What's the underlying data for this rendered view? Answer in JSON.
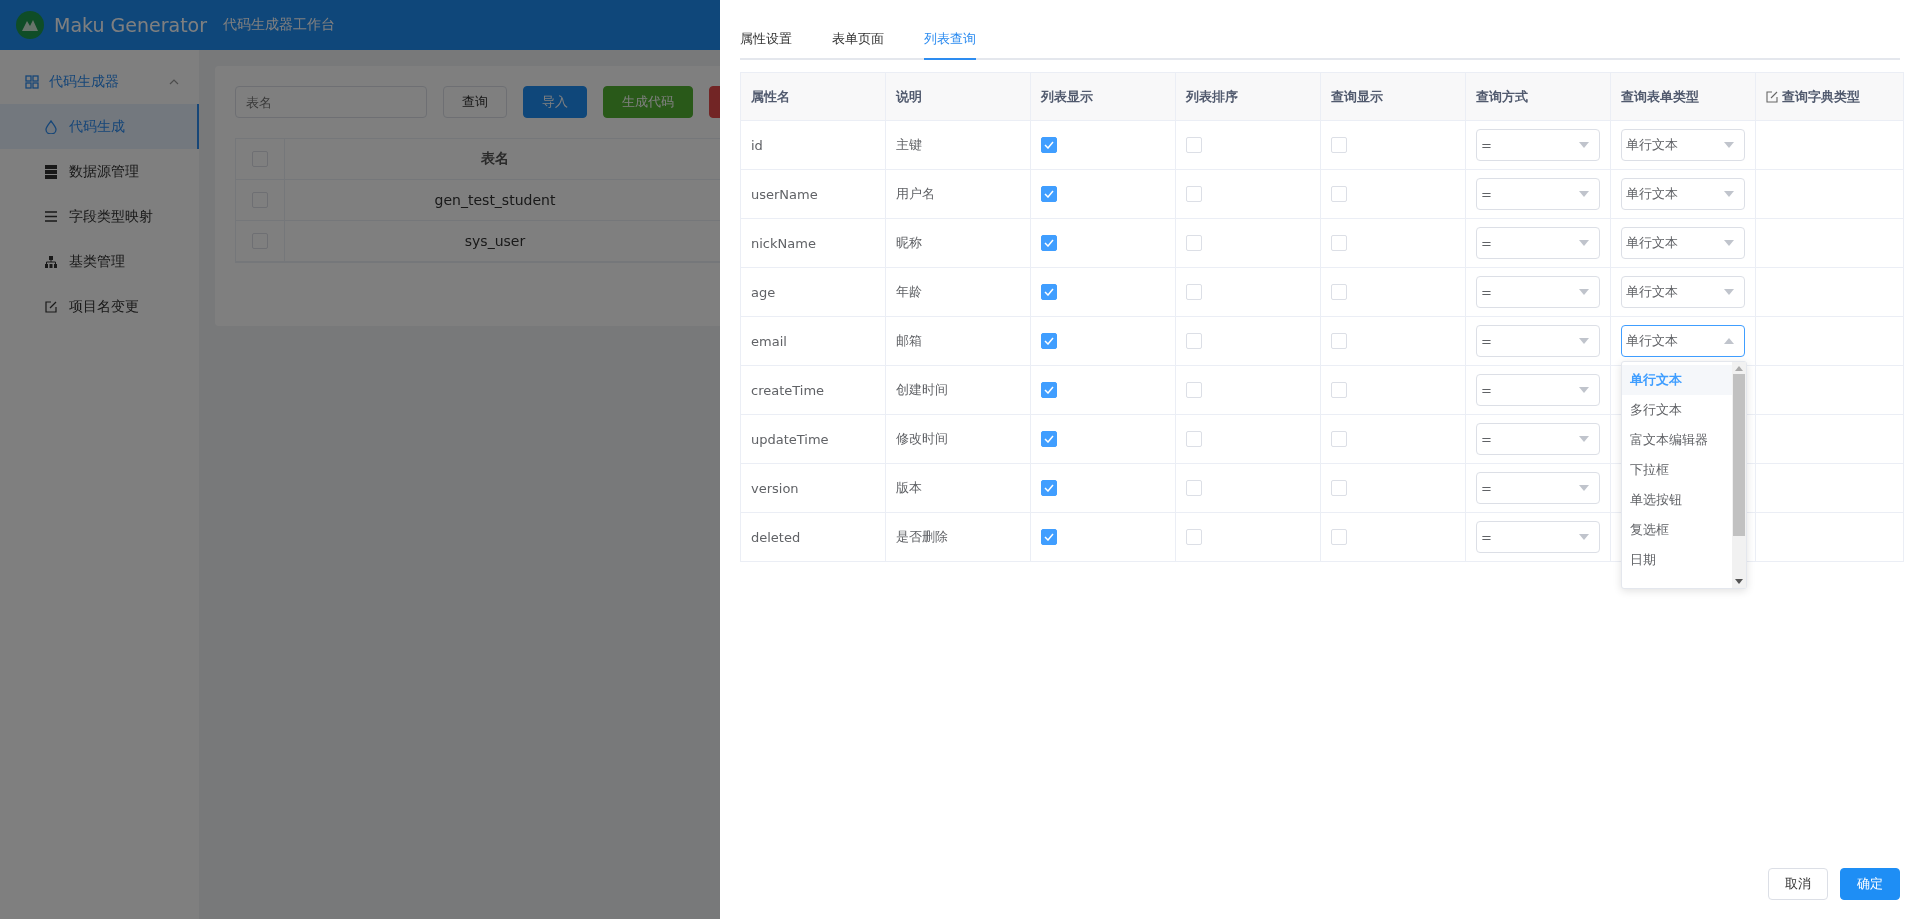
{
  "app": {
    "brand": "Maku Generator",
    "subtitle": "代码生成器工作台"
  },
  "sidebar": {
    "groups": [
      {
        "label": "代码生成器",
        "expanded": true,
        "children": [
          {
            "label": "代码生成",
            "selected": true
          },
          {
            "label": "数据源管理",
            "selected": false
          },
          {
            "label": "字段类型映射",
            "selected": false
          },
          {
            "label": "基类管理",
            "selected": false
          },
          {
            "label": "项目名变更",
            "selected": false
          }
        ]
      }
    ]
  },
  "toolbar": {
    "search": {
      "placeholder": "表名"
    },
    "buttons": [
      {
        "label": "查询",
        "kind": "default"
      },
      {
        "label": "导入",
        "kind": "primary"
      },
      {
        "label": "生成代码",
        "kind": "success"
      },
      {
        "kind": "danger"
      }
    ]
  },
  "table": {
    "select_all": false,
    "columns": [
      "表名"
    ],
    "rows": [
      {
        "name": "gen_test_student",
        "checked": false
      },
      {
        "name": "sys_user",
        "checked": false
      }
    ]
  },
  "drawer": {
    "tabs": [
      {
        "label": "属性设置",
        "selected": false
      },
      {
        "label": "表单页面",
        "selected": false
      },
      {
        "label": "列表查询",
        "selected": true
      }
    ],
    "columns": [
      "属性名",
      "说明",
      "列表显示",
      "列表排序",
      "查询显示",
      "查询方式",
      "查询表单类型",
      "查询字典类型"
    ],
    "rows": [
      {
        "name": "id",
        "comment": "主键",
        "list_show": true,
        "list_sort": false,
        "query_show": false,
        "query_type": "=",
        "form_type": "单行文本",
        "open": false
      },
      {
        "name": "userName",
        "comment": "用户名",
        "list_show": true,
        "list_sort": false,
        "query_show": false,
        "query_type": "=",
        "form_type": "单行文本",
        "open": false
      },
      {
        "name": "nickName",
        "comment": "昵称",
        "list_show": true,
        "list_sort": false,
        "query_show": false,
        "query_type": "=",
        "form_type": "单行文本",
        "open": false
      },
      {
        "name": "age",
        "comment": "年龄",
        "list_show": true,
        "list_sort": false,
        "query_show": false,
        "query_type": "=",
        "form_type": "单行文本",
        "open": false
      },
      {
        "name": "email",
        "comment": "邮箱",
        "list_show": true,
        "list_sort": false,
        "query_show": false,
        "query_type": "=",
        "form_type": "单行文本",
        "open": true
      },
      {
        "name": "createTime",
        "comment": "创建时间",
        "list_show": true,
        "list_sort": false,
        "query_show": false,
        "query_type": "=",
        "open": false
      },
      {
        "name": "updateTime",
        "comment": "修改时间",
        "list_show": true,
        "list_sort": false,
        "query_show": false,
        "query_type": "=",
        "open": false
      },
      {
        "name": "version",
        "comment": "版本",
        "list_show": true,
        "list_sort": false,
        "query_show": false,
        "query_type": "=",
        "open": false
      },
      {
        "name": "deleted",
        "comment": "是否删除",
        "list_show": true,
        "list_sort": false,
        "query_show": false,
        "query_type": "=",
        "open": false
      }
    ],
    "dropdown": {
      "options": [
        {
          "label": "单行文本",
          "selected": true
        },
        {
          "label": "多行文本",
          "selected": false
        },
        {
          "label": "富文本编辑器",
          "selected": false
        },
        {
          "label": "下拉框",
          "selected": false
        },
        {
          "label": "单选按钮",
          "selected": false
        },
        {
          "label": "复选框",
          "selected": false
        },
        {
          "label": "日期",
          "selected": false
        }
      ]
    },
    "buttons": [
      {
        "label": "取消",
        "kind": "default"
      },
      {
        "label": "确定",
        "kind": "primary"
      }
    ]
  }
}
